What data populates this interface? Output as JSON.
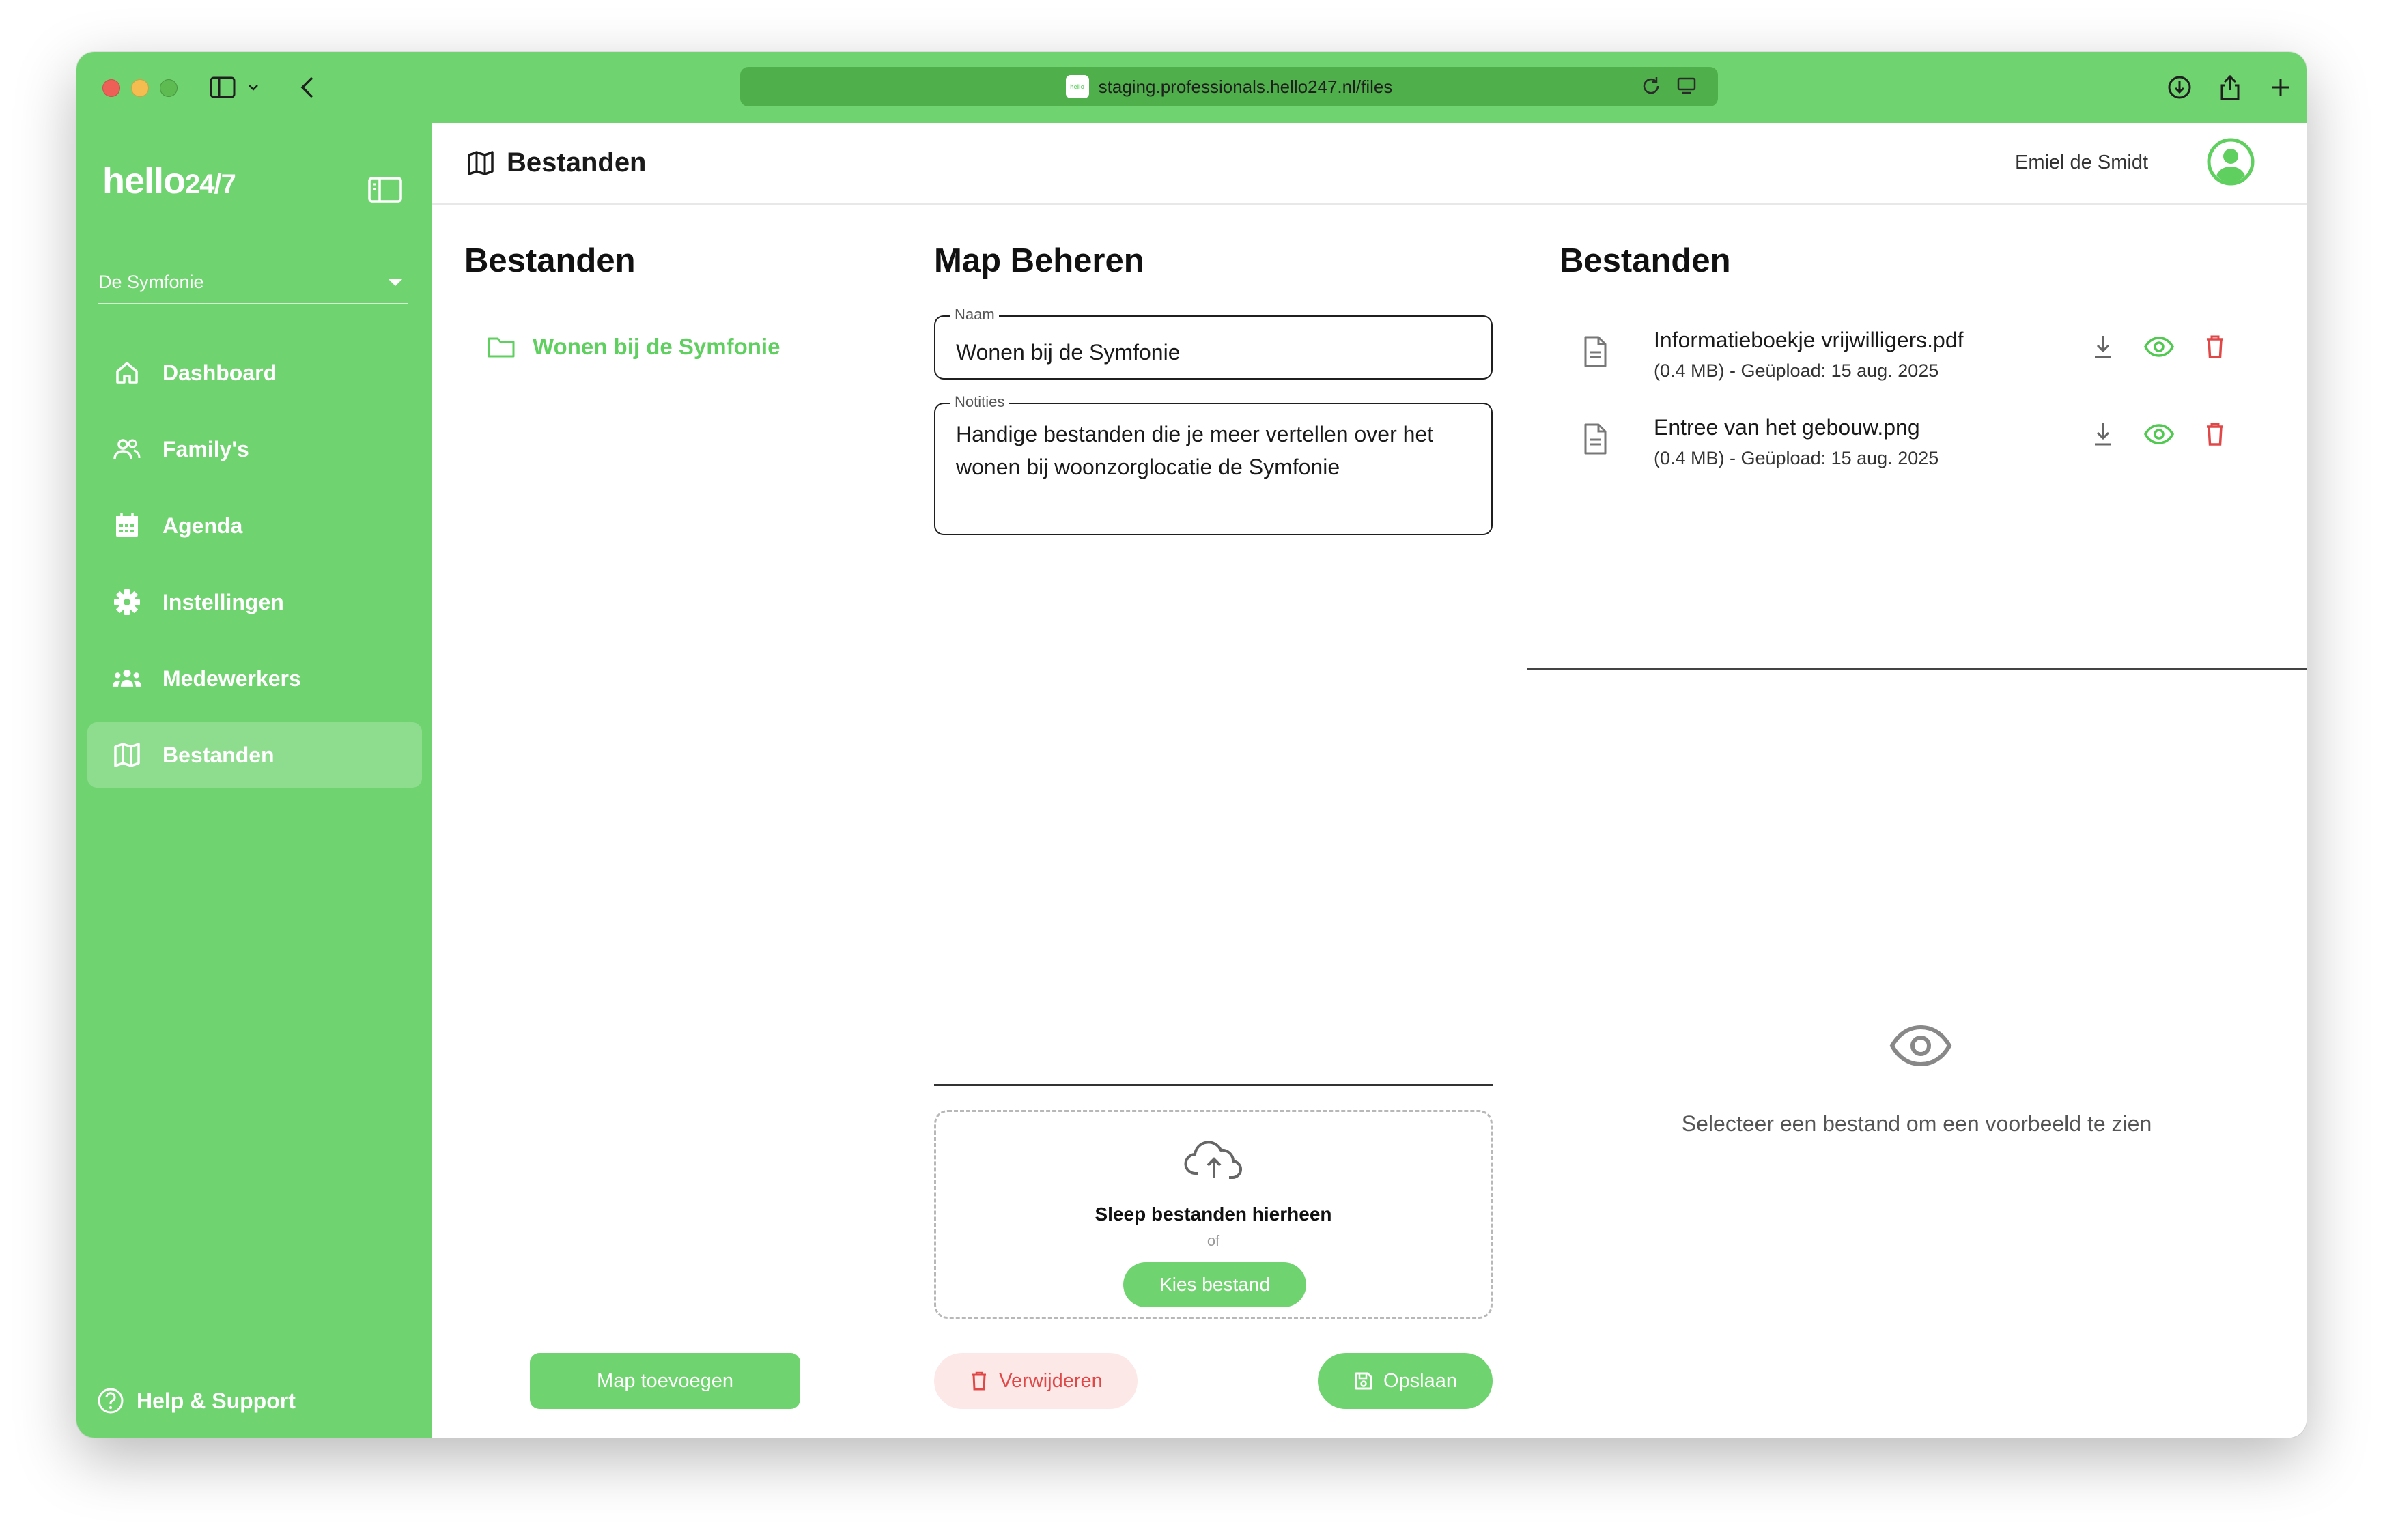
{
  "browser": {
    "url": "staging.professionals.hello247.nl/files",
    "favicon_text": "hello"
  },
  "sidebar": {
    "logo_main": "hello",
    "logo_sub": "24/7",
    "org": "De Symfonie",
    "items": [
      {
        "label": "Dashboard",
        "icon": "home-icon"
      },
      {
        "label": "Family's",
        "icon": "users-icon"
      },
      {
        "label": "Agenda",
        "icon": "calendar-icon"
      },
      {
        "label": "Instellingen",
        "icon": "gear-icon"
      },
      {
        "label": "Medewerkers",
        "icon": "team-icon"
      },
      {
        "label": "Bestanden",
        "icon": "map-icon",
        "active": true
      }
    ],
    "help": "Help & Support"
  },
  "header": {
    "title": "Bestanden",
    "user": "Emiel de Smidt"
  },
  "folders_panel": {
    "title": "Bestanden",
    "folders": [
      "Wonen bij de Symfonie"
    ],
    "add_button": "Map toevoegen"
  },
  "manage_panel": {
    "title": "Map Beheren",
    "name_label": "Naam",
    "name_value": "Wonen bij de Symfonie",
    "notes_label": "Notities",
    "notes_value": "Handige bestanden die je meer vertellen over het wonen bij woonzorglocatie de Symfonie",
    "drop_title": "Sleep bestanden hierheen",
    "drop_or": "of",
    "choose_button": "Kies bestand",
    "delete_button": "Verwijderen",
    "save_button": "Opslaan"
  },
  "files_panel": {
    "title": "Bestanden",
    "files": [
      {
        "name": "Informatieboekje vrijwilligers.pdf",
        "meta": "(0.4 MB) - Geüpload: 15 aug. 2025"
      },
      {
        "name": "Entree van het gebouw.png",
        "meta": "(0.4 MB) - Geüpload: 15 aug. 2025"
      }
    ],
    "preview_placeholder": "Selecteer een bestand om een voorbeeld te zien"
  },
  "colors": {
    "brand_green": "#6fd36f",
    "delete_red": "#e04848",
    "text_dark": "#1a1a1a"
  }
}
